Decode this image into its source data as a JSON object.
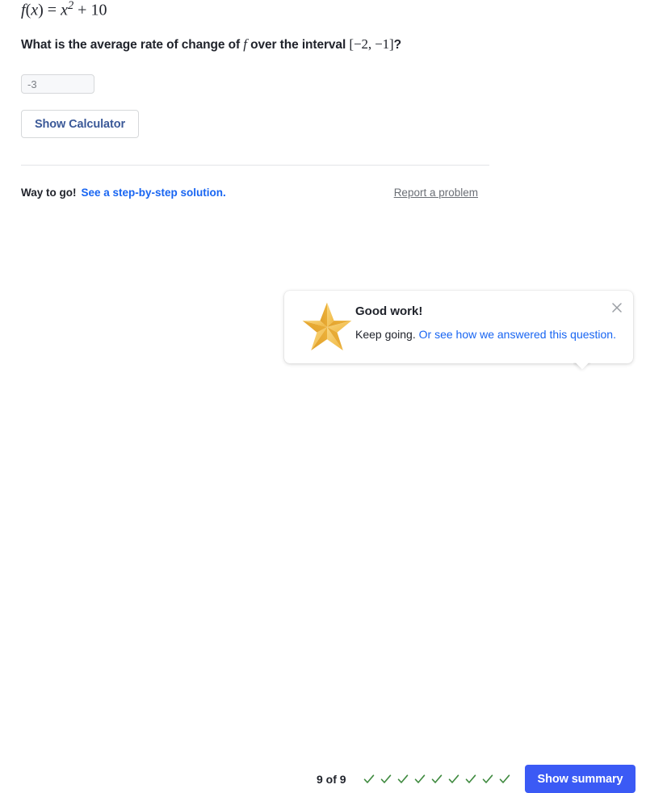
{
  "problem": {
    "formula": {
      "fn": "f",
      "open": "(",
      "var": "x",
      "close": ")",
      "equals": "=",
      "base": "x",
      "exponent": "2",
      "plus": "+",
      "constant": "10"
    },
    "question": {
      "part1": "What is the average rate of change of",
      "fn": "f",
      "part2": "over the interval",
      "interval": "[−2, −1]",
      "part3": "?"
    }
  },
  "answer": {
    "value": "-3",
    "placeholder": "-3"
  },
  "calculator": {
    "label": "Show Calculator"
  },
  "feedback": {
    "praise": "Way to go!",
    "solution_link": "See a step-by-step solution.",
    "report_link": "Report a problem"
  },
  "toast": {
    "icon": "star-icon",
    "title": "Good work!",
    "body_text": "Keep going.",
    "body_link": "Or see how we answered this question.",
    "close_icon": "close-icon"
  },
  "bottom": {
    "progress_label": "9 of 9",
    "checks": [
      "check-icon",
      "check-icon",
      "check-icon",
      "check-icon",
      "check-icon",
      "check-icon",
      "check-icon",
      "check-icon",
      "check-icon"
    ],
    "summary_label": "Show summary"
  },
  "colors": {
    "link_blue": "#1865f2",
    "button_blue": "#3b5af5",
    "calculator_blue": "#3b5998",
    "check_green": "#3f8a3f",
    "star_gold": "#f0b63e",
    "text_dark": "#21242c",
    "muted_gray": "#6b6f76"
  }
}
